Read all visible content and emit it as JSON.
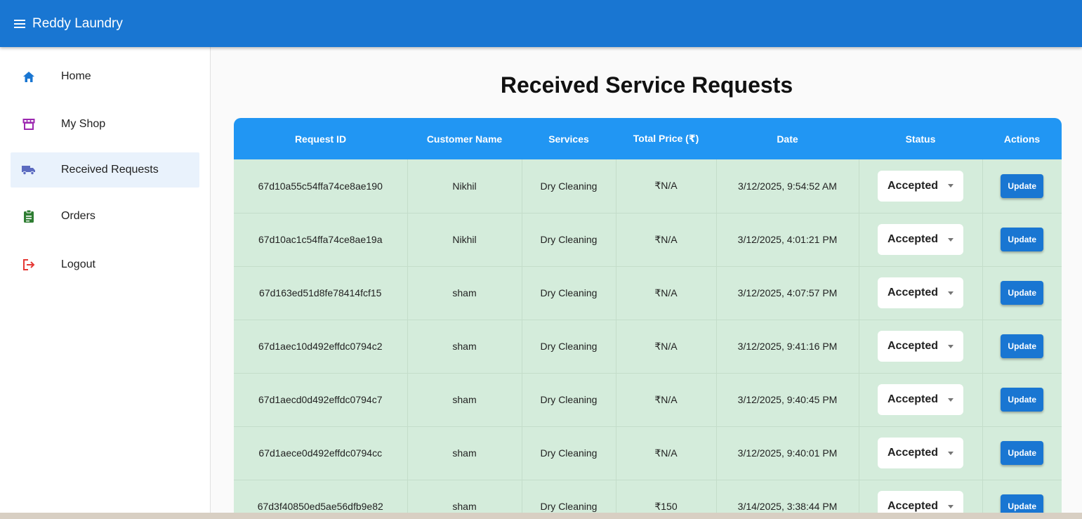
{
  "app": {
    "title": "Reddy Laundry"
  },
  "sidebar": {
    "items": [
      {
        "label": "Home",
        "icon": "home-icon",
        "color": "#1976d2"
      },
      {
        "label": "My Shop",
        "icon": "storefront-icon",
        "color": "#9c27b0"
      },
      {
        "label": "Received Requests",
        "icon": "truck-icon",
        "color": "#5c6bc0",
        "active": true
      },
      {
        "label": "Orders",
        "icon": "clipboard-icon",
        "color": "#2e7d32"
      },
      {
        "label": "Logout",
        "icon": "logout-icon",
        "color": "#e53935"
      }
    ]
  },
  "main": {
    "title": "Received Service Requests",
    "columns": [
      "Request ID",
      "Customer Name",
      "Services",
      "Total Price (₹)",
      "Date",
      "Status",
      "Actions"
    ],
    "rows": [
      {
        "id": "67d10a55c54ffa74ce8ae190",
        "customer": "Nikhil",
        "service": "Dry Cleaning",
        "price": "₹N/A",
        "date": "3/12/2025, 9:54:52 AM",
        "status": "Accepted",
        "action": "Update"
      },
      {
        "id": "67d10ac1c54ffa74ce8ae19a",
        "customer": "Nikhil",
        "service": "Dry Cleaning",
        "price": "₹N/A",
        "date": "3/12/2025, 4:01:21 PM",
        "status": "Accepted",
        "action": "Update"
      },
      {
        "id": "67d163ed51d8fe78414fcf15",
        "customer": "sham",
        "service": "Dry Cleaning",
        "price": "₹N/A",
        "date": "3/12/2025, 4:07:57 PM",
        "status": "Accepted",
        "action": "Update"
      },
      {
        "id": "67d1aec10d492effdc0794c2",
        "customer": "sham",
        "service": "Dry Cleaning",
        "price": "₹N/A",
        "date": "3/12/2025, 9:41:16 PM",
        "status": "Accepted",
        "action": "Update"
      },
      {
        "id": "67d1aecd0d492effdc0794c7",
        "customer": "sham",
        "service": "Dry Cleaning",
        "price": "₹N/A",
        "date": "3/12/2025, 9:40:45 PM",
        "status": "Accepted",
        "action": "Update"
      },
      {
        "id": "67d1aece0d492effdc0794cc",
        "customer": "sham",
        "service": "Dry Cleaning",
        "price": "₹N/A",
        "date": "3/12/2025, 9:40:01 PM",
        "status": "Accepted",
        "action": "Update"
      },
      {
        "id": "67d3f40850ed5ae56dfb9e82",
        "customer": "sham",
        "service": "Dry Cleaning",
        "price": "₹150",
        "date": "3/14/2025, 3:38:44 PM",
        "status": "Accepted",
        "action": "Update"
      }
    ]
  },
  "colors": {
    "appbar": "#1976d2",
    "table_header": "#2196f3",
    "row_bg": "#d4ecdb",
    "active_nav": "#e9f2fc"
  }
}
